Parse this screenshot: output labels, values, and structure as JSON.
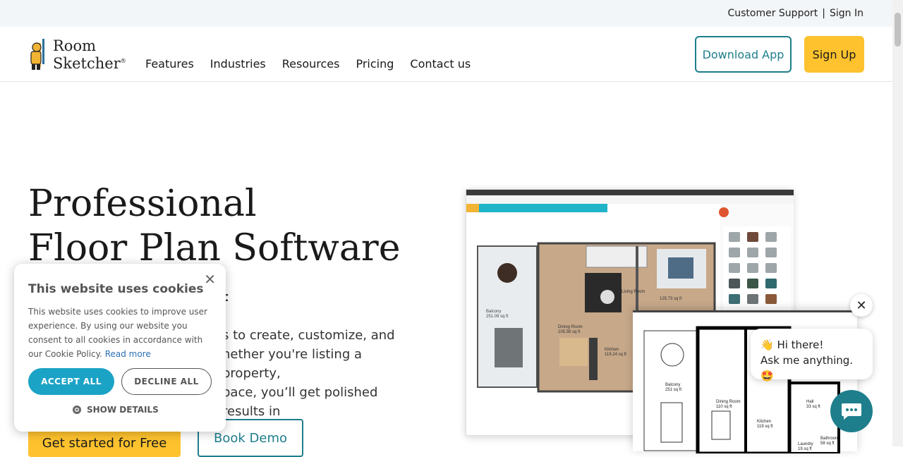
{
  "topbar": {
    "support": "Customer Support",
    "separator": "|",
    "signin": "Sign In"
  },
  "logo": {
    "line1": "Room",
    "line2": "Sketcher",
    "mark": "®"
  },
  "nav": [
    "Features",
    "Industries",
    "Resources",
    "Pricing",
    "Contact us"
  ],
  "header": {
    "download": "Download App",
    "signup": "Sign Up"
  },
  "hero": {
    "title_line1": "Professional",
    "title_line2": "Floor Plan Software",
    "subtitle_visible": "t",
    "desc_line1": "s to create, customize, and",
    "desc_line2": "hether you're listing a property,",
    "desc_line3": "pace, you’ll get polished results in",
    "cta_start": "Get started for Free",
    "cta_demo": "Book Demo"
  },
  "cookie": {
    "close": "✕",
    "title": "This website uses cookies",
    "body": "This website uses cookies to improve user experience. By using our website you consent to all cookies in accordance with our Cookie Policy.",
    "read_more": "Read more",
    "accept": "ACCEPT ALL",
    "decline": "DECLINE ALL",
    "show_details": "SHOW DETAILS"
  },
  "floorplan": {
    "labels": [
      "Balcony",
      "251.09 sq ft",
      "Dining Room",
      "105.56 sq ft",
      "Kitchen",
      "119.24 sq ft",
      "Living Room",
      "125.73 sq ft"
    ],
    "labels2": [
      "Balcony",
      "251 sq ft",
      "Dining Room",
      "110 sq ft",
      "Kitchen",
      "119 sq ft",
      "Hall",
      "33 sq ft",
      "Bathroom",
      "58 sq ft",
      "Laundry",
      "19 sq ft"
    ]
  },
  "chat": {
    "close": "✕",
    "line1": "👋 Hi there!",
    "line2": "Ask me anything.🤩"
  },
  "colors": {
    "teal": "#1e7e8c",
    "yellow": "#fdc22e",
    "cookie_accept": "#1ba3c6"
  }
}
